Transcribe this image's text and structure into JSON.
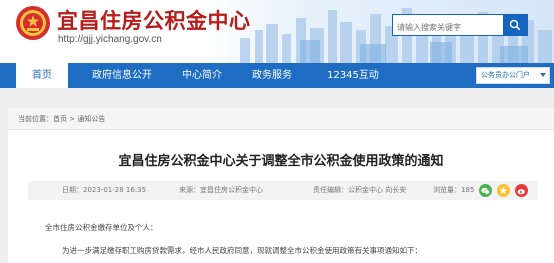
{
  "header": {
    "site_title": "宜昌住房公积金中心",
    "site_url": "http://gjj.yichang.gov.cn",
    "search_placeholder": "请输入搜索关键字"
  },
  "nav": {
    "items": [
      {
        "label": "首页",
        "active": true
      },
      {
        "label": "政府信息公开",
        "active": false
      },
      {
        "label": "中心简介",
        "active": false
      },
      {
        "label": "政务服务",
        "active": false
      },
      {
        "label": "12345互动",
        "active": false
      }
    ],
    "quick_select": "公务员办公门户"
  },
  "breadcrumb": {
    "prefix": "当前位置：",
    "home": "首页",
    "separator": ">",
    "current": "通知公告"
  },
  "article": {
    "title": "宜昌住房公积金中心关于调整全市公积金使用政策的通知",
    "date": "日期：2023-01-28 16:35",
    "source": "来源：宜昌住房公积金中心",
    "editor": "责任编辑：公积金中心 向长安",
    "views": "浏览量：185",
    "para1": "全市住房公积金缴存单位及个人：",
    "para2": "为进一步满足缴存职工购房贷款需求，经市人民政府同意，现就调整全市公积金使用政策有关事项通知如下："
  },
  "colors": {
    "brand_red": "#b71c1c",
    "nav_blue": "#1f6dc2"
  }
}
